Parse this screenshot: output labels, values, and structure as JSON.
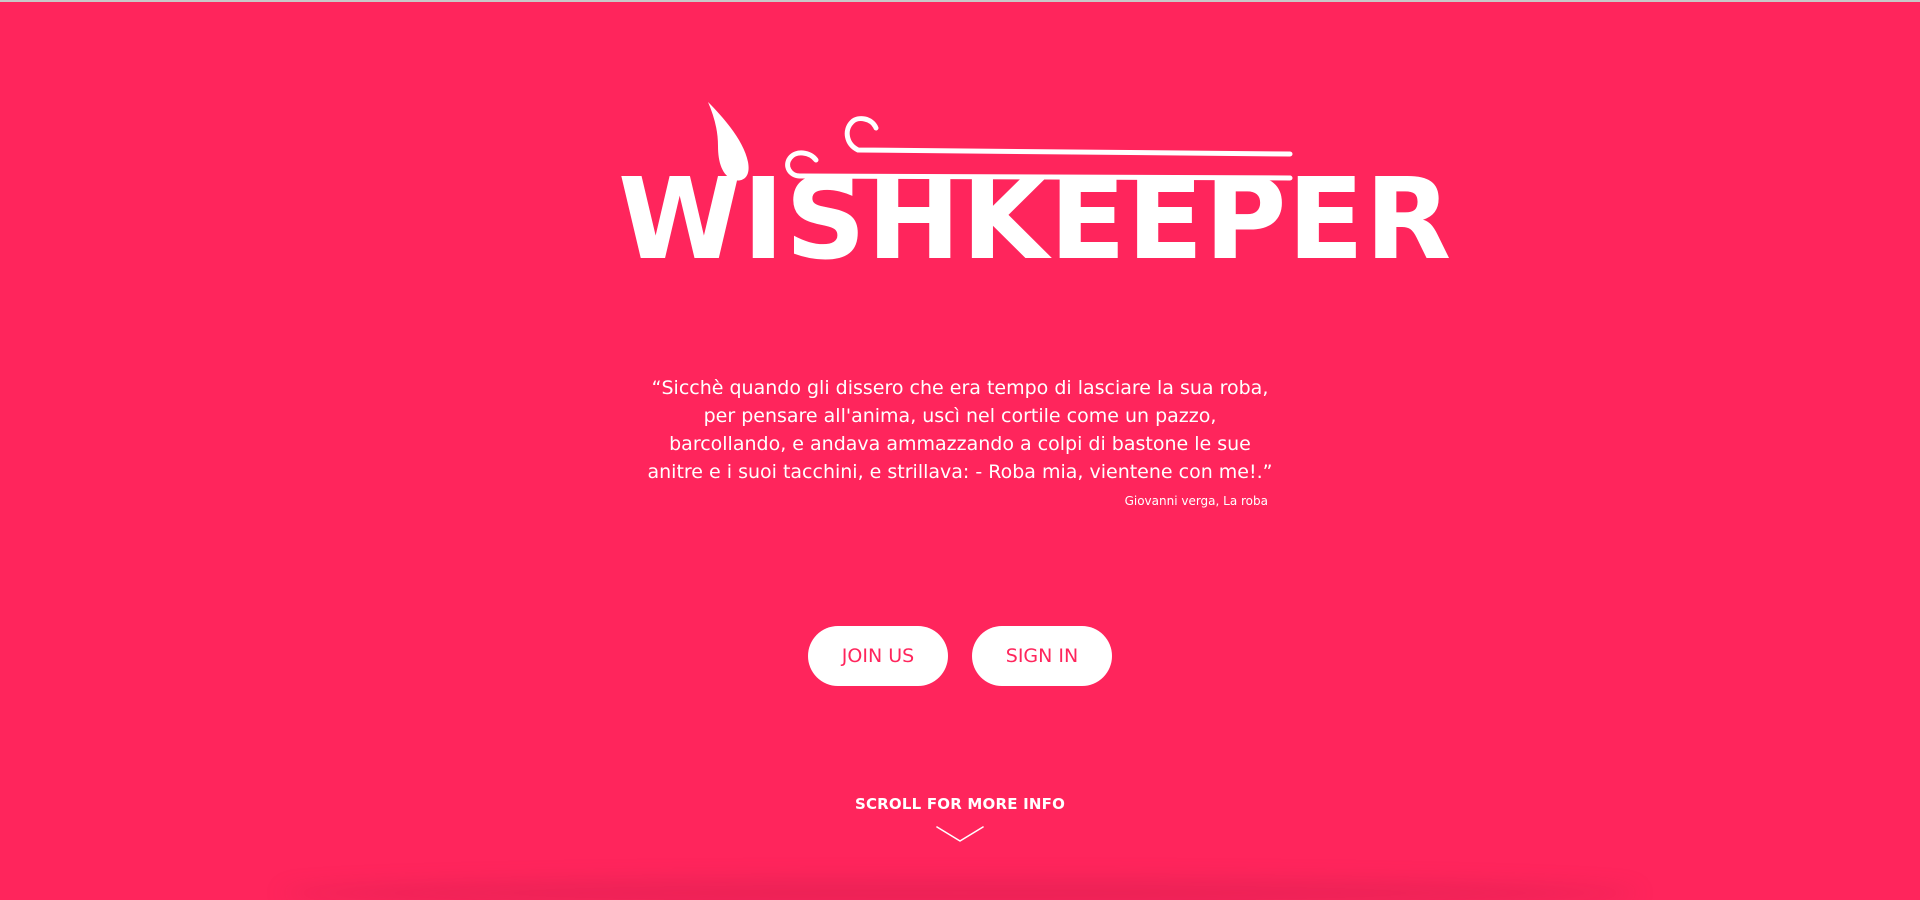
{
  "colors": {
    "background": "#ff255c",
    "foreground": "#ffffff",
    "button_text": "#ff255c"
  },
  "logo": {
    "text": "WISHKEEPER",
    "icon": "wish-drop-wind-icon"
  },
  "quote": {
    "lines": [
      "“Sicchè quando gli dissero che era tempo di lasciare la sua roba,",
      "per pensare all'anima, uscì nel cortile come un pazzo,",
      "barcollando, e andava ammazzando a colpi di bastone le sue",
      "anitre e i suoi tacchini, e strillava: - Roba mia, vientene con me!.”"
    ],
    "author": "Giovanni verga, La roba"
  },
  "actions": {
    "join_label": "JOIN US",
    "signin_label": "SIGN IN"
  },
  "scroll": {
    "label": "SCROLL FOR MORE INFO",
    "icon": "chevron-down-icon"
  }
}
